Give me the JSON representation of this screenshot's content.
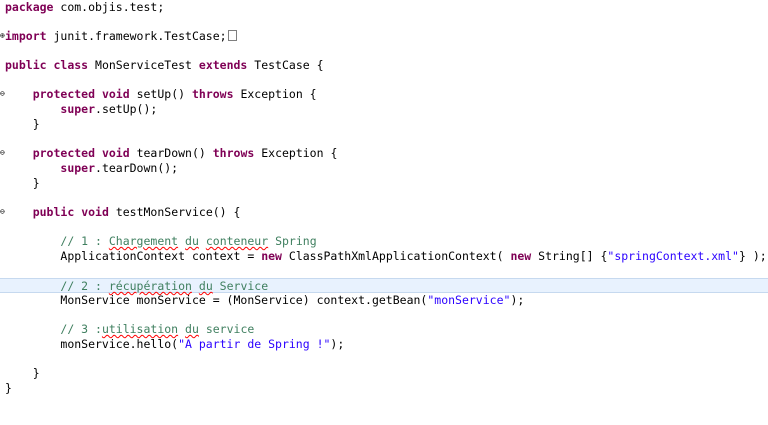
{
  "code": {
    "package_kw": "package",
    "package_name": " com.objis.test;",
    "import_kw": "import",
    "import_name": " junit.framework.TestCase;",
    "class_public": "public",
    "class_kw": "class",
    "class_name": " MonServiceTest ",
    "extends_kw": "extends",
    "extends_rest": " TestCase {",
    "protected": "protected",
    "void": "void",
    "setup_sig": " setUp() ",
    "throws": "throws",
    "exception_brace": " Exception {",
    "super": "super",
    "setup_call": ".setUp();",
    "close_brace": "}",
    "teardown_sig": " tearDown() ",
    "teardown_call": ".tearDown();",
    "public": "public",
    "test_sig": " testMonService() {",
    "comment1_prefix": "// 1 : ",
    "comment1_word1": "Chargement",
    "comment1_sp1": " ",
    "comment1_word2": "du",
    "comment1_sp2": " ",
    "comment1_word3": "conteneur",
    "comment1_rest": " Spring",
    "ctx_decl": "ApplicationContext context = ",
    "new": "new",
    "ctx_class": " ClassPathXmlApplicationContext( ",
    "string_arr": " String[] {",
    "spring_xml": "\"springContext.xml\"",
    "ctx_end": "} );",
    "comment2_prefix": "// 2 : ",
    "comment2_word1": "récupération",
    "comment2_sp1": " ",
    "comment2_word2": "du",
    "comment2_rest": " Service",
    "bean_decl": "MonService monService = (MonService) context.getBean(",
    "mon_service_str": "\"monService\"",
    "bean_end": ");",
    "comment3_prefix": "// 3 :",
    "comment3_word1": "utilisation",
    "comment3_sp1": " ",
    "comment3_word2": "du",
    "comment3_rest": " service",
    "hello_call": "monService.hello(",
    "hello_str": "\"A partir de Spring !\"",
    "hello_end": ");"
  }
}
